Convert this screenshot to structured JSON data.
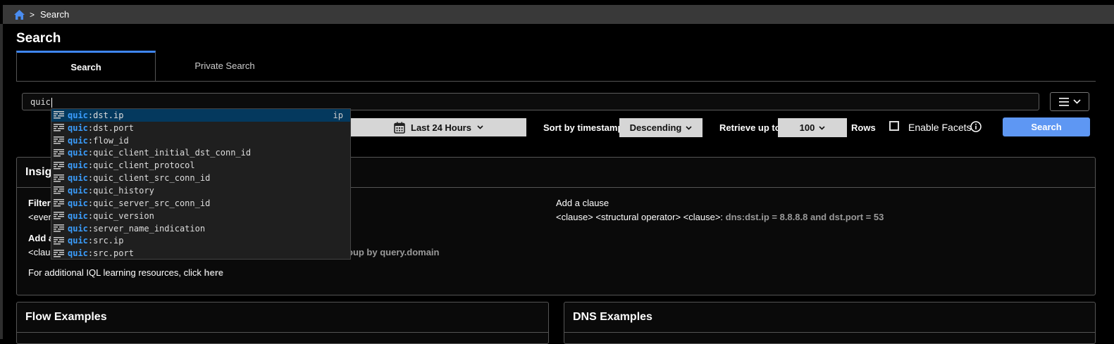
{
  "breadcrumb": {
    "separator": ">",
    "current": "Search"
  },
  "page_title": "Search",
  "tabs": [
    {
      "label": "Search",
      "active": true
    },
    {
      "label": "Private Search",
      "active": false
    }
  ],
  "search": {
    "value": "quic"
  },
  "autocomplete": {
    "prefix": "quic",
    "items": [
      {
        "prefix": "quic",
        "field": ":dst.ip",
        "type": "ip",
        "selected": true
      },
      {
        "prefix": "quic",
        "field": ":dst.port"
      },
      {
        "prefix": "quic",
        "field": ":flow_id"
      },
      {
        "prefix": "quic",
        "field": ":quic_client_initial_dst_conn_id"
      },
      {
        "prefix": "quic",
        "field": ":quic_client_protocol"
      },
      {
        "prefix": "quic",
        "field": ":quic_client_src_conn_id"
      },
      {
        "prefix": "quic",
        "field": ":quic_history"
      },
      {
        "prefix": "quic",
        "field": ":quic_server_src_conn_id"
      },
      {
        "prefix": "quic",
        "field": ":quic_version"
      },
      {
        "prefix": "quic",
        "field": ":server_name_indication"
      },
      {
        "prefix": "quic",
        "field": ":src.ip"
      },
      {
        "prefix": "quic",
        "field": ":src.port"
      }
    ]
  },
  "controls": {
    "time_range": "Last 24 Hours",
    "sort_label": "Sort by timestamp",
    "sort_value": "Descending",
    "retrieve_label": "Retrieve up to",
    "rows_value": "100",
    "rows_label": "Rows",
    "facets_label": "Enable Facets",
    "search_button": "Search"
  },
  "insights": {
    "title_partial": "Insig",
    "filter_partial": "Filter",
    "event_partial": "<even",
    "add_partial": "Add a",
    "clause_partial": "<claus",
    "group_partial": "oup by query.domain",
    "add_clause_title": "Add a clause",
    "add_clause_syntax": "<clause> <structural operator> <clause>:",
    "add_clause_example": "dns:dst.ip = 8.8.8.8 and dst.port = 53",
    "footer_text": "For additional IQL learning resources, click",
    "footer_link": "here"
  },
  "flow_examples": {
    "title": "Flow Examples"
  },
  "dns_examples": {
    "title": "DNS Examples"
  },
  "colors": {
    "accent": "#3f86f5",
    "search_button": "#5e97f3",
    "autocomplete_prefix": "#3b9eff",
    "selected_row": "#04395e"
  }
}
